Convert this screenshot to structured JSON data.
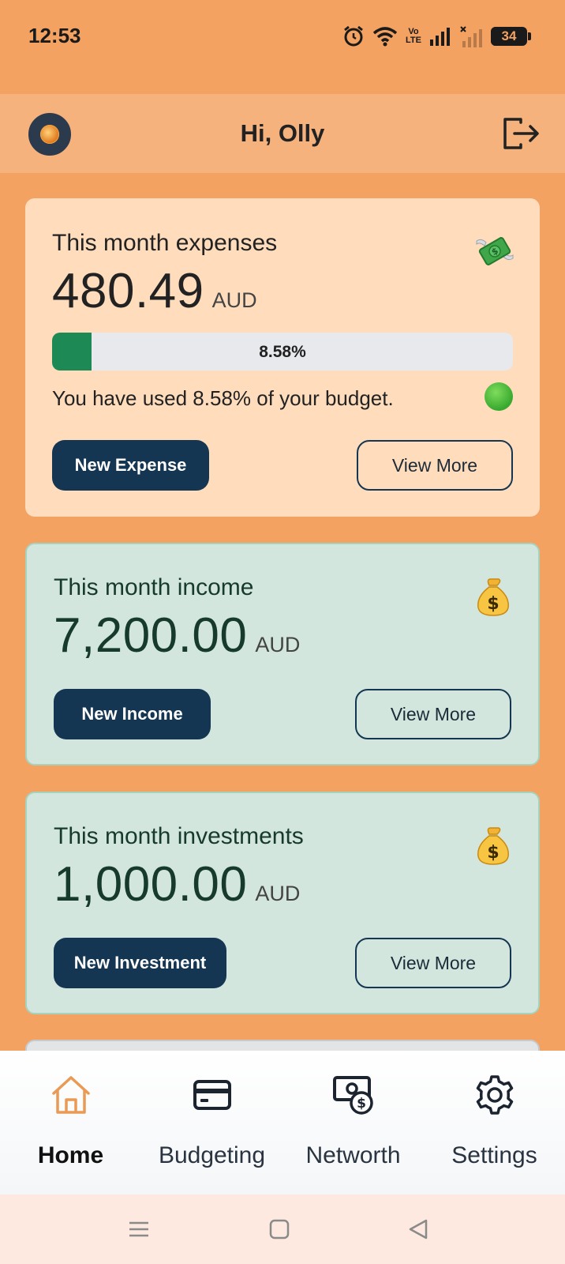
{
  "status_bar": {
    "time": "12:53",
    "battery_level": "34",
    "network_label_top": "Vo",
    "network_label_bottom": "LTE"
  },
  "header": {
    "greeting": "Hi, Olly",
    "avatar_icon": "app-logo-avatar",
    "logout_icon": "logout-icon"
  },
  "expenses_card": {
    "title": "This month expenses",
    "amount": "480.49",
    "currency": "AUD",
    "emoji": "money-with-wings-icon",
    "progress_label": "8.58%",
    "progress_value_percent": 8.58,
    "budget_message": "You have used 8.58% of your budget.",
    "status_indicator": "green-circle",
    "primary_button": "New Expense",
    "secondary_button": "View More"
  },
  "income_card": {
    "title": "This month income",
    "amount": "7,200.00",
    "currency": "AUD",
    "emoji": "money-bag-icon",
    "primary_button": "New Income",
    "secondary_button": "View More"
  },
  "investments_card": {
    "title": "This month investments",
    "amount": "1,000.00",
    "currency": "AUD",
    "emoji": "money-bag-icon",
    "primary_button": "New Investment",
    "secondary_button": "View More"
  },
  "bottom_nav": {
    "items": [
      {
        "label": "Home",
        "icon": "home-icon",
        "active": true
      },
      {
        "label": "Budgeting",
        "icon": "credit-card-icon",
        "active": false
      },
      {
        "label": "Networth",
        "icon": "cash-icon",
        "active": false
      },
      {
        "label": "Settings",
        "icon": "gear-icon",
        "active": false
      }
    ]
  },
  "colors": {
    "background": "#f3a262",
    "header": "#f5b27c",
    "expense_card": "#fedcbc",
    "income_card": "#d3e6dd",
    "primary_button": "#143652",
    "progress_fill": "#1d8a55",
    "active_nav_icon": "#e99a55"
  }
}
